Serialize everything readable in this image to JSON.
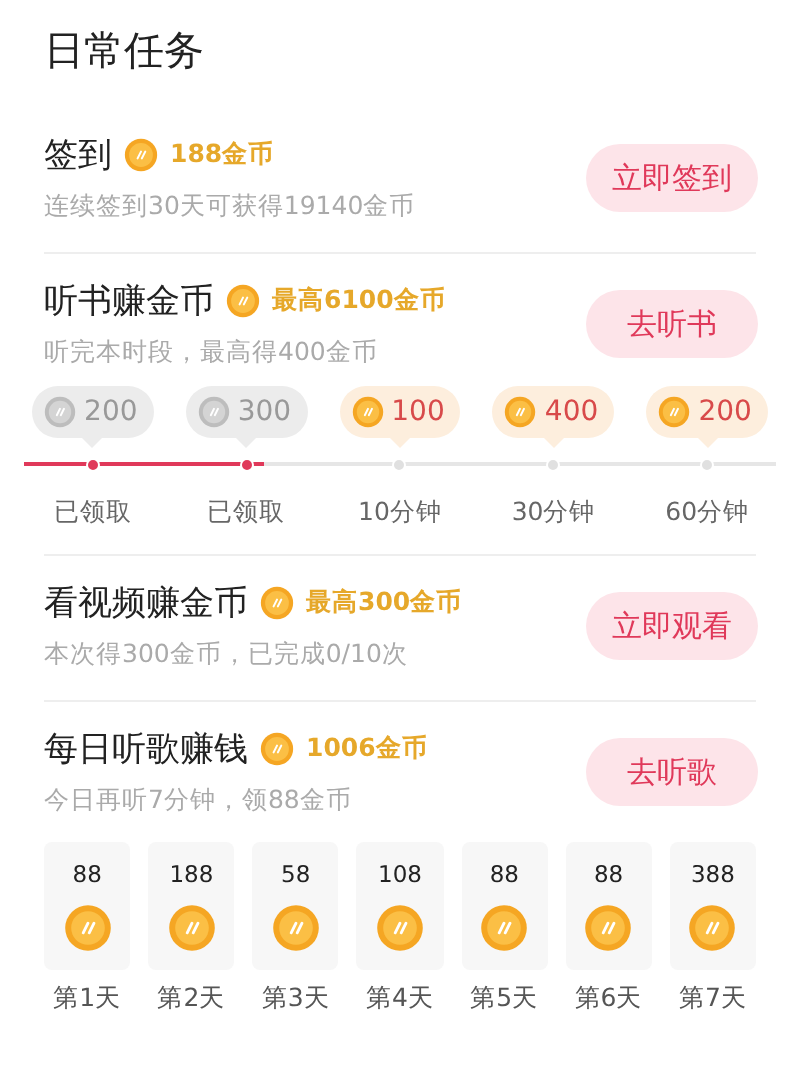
{
  "title": "日常任务",
  "tasks": [
    {
      "kind": "plain",
      "title": "签到",
      "reward": "188金币",
      "subtitle": "连续签到30天可获得19140金币",
      "button": "立即签到"
    },
    {
      "kind": "milestones",
      "title": "听书赚金币",
      "reward": "最高6100金币",
      "subtitle": "听完本时段，最高得400金币",
      "button": "去听书",
      "level": 0.32,
      "milestones": [
        {
          "amount": "200",
          "label": "已领取",
          "collected": true
        },
        {
          "amount": "300",
          "label": "已领取",
          "collected": true
        },
        {
          "amount": "100",
          "label": "10分钟",
          "collected": false
        },
        {
          "amount": "400",
          "label": "30分钟",
          "collected": false
        },
        {
          "amount": "200",
          "label": "60分钟",
          "collected": false
        }
      ]
    },
    {
      "kind": "plain",
      "title": "看视频赚金币",
      "reward": "最高300金币",
      "subtitle": "本次得300金币，已完成0/10次",
      "button": "立即观看"
    },
    {
      "kind": "daily",
      "title": "每日听歌赚钱",
      "reward": "1006金币",
      "subtitle": "今日再听7分钟，领88金币",
      "button": "去听歌",
      "days": [
        {
          "amount": "88",
          "label": "第1天"
        },
        {
          "amount": "188",
          "label": "第2天"
        },
        {
          "amount": "58",
          "label": "第3天"
        },
        {
          "amount": "108",
          "label": "第4天"
        },
        {
          "amount": "88",
          "label": "第5天"
        },
        {
          "amount": "88",
          "label": "第6天"
        },
        {
          "amount": "388",
          "label": "第7天"
        }
      ]
    }
  ]
}
